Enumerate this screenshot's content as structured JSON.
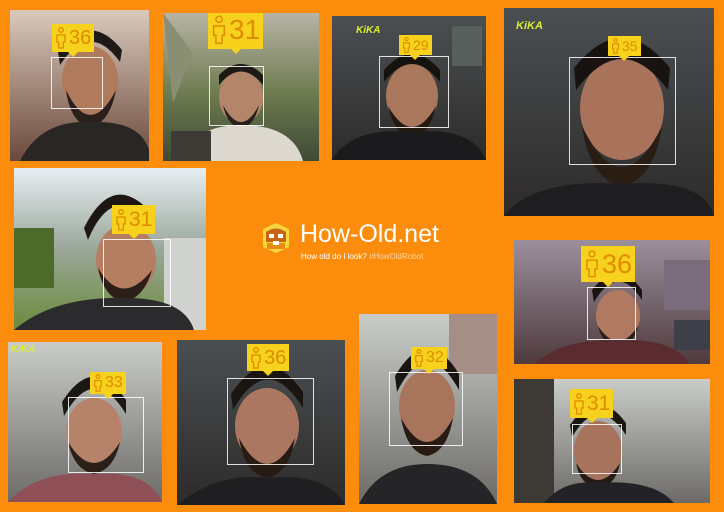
{
  "app": {
    "title": "How-Old.net",
    "tagline": "How old do I look?",
    "hashtag": "#HowOldRobot"
  },
  "colors": {
    "background": "#fb8c0c",
    "tag_fill": "#f7d21d",
    "tag_text": "#e08a00",
    "face_box": "#ffffff"
  },
  "icons": {
    "person": "person-icon",
    "logo": "robot-face-logo"
  },
  "photos": [
    {
      "estimated_age": "36"
    },
    {
      "estimated_age": "31"
    },
    {
      "estimated_age": "29",
      "watermark": "KiKA"
    },
    {
      "estimated_age": "35",
      "watermark": "KiKA"
    },
    {
      "estimated_age": "31"
    },
    {
      "estimated_age": "36"
    },
    {
      "estimated_age": "33",
      "watermark": "KiKA"
    },
    {
      "estimated_age": "36"
    },
    {
      "estimated_age": "32"
    },
    {
      "estimated_age": "31"
    }
  ]
}
